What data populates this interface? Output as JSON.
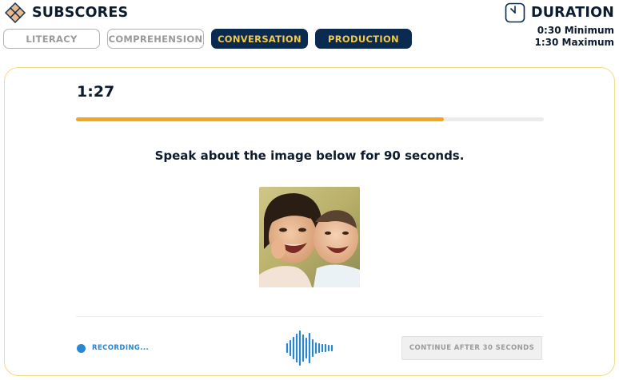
{
  "header": {
    "subscores_title": "SUBSCORES",
    "logo_icon": "diamond-grid-logo-icon",
    "duration_title": "DURATION",
    "duration_icon": "clock-icon",
    "duration_min": "0:30 Minimum",
    "duration_max": "1:30 Maximum"
  },
  "subscores": [
    {
      "label": "LITERACY",
      "active": false
    },
    {
      "label": "COMPREHENSION",
      "active": false
    },
    {
      "label": "CONVERSATION",
      "active": true
    },
    {
      "label": "PRODUCTION",
      "active": true
    }
  ],
  "task": {
    "timer": "1:27",
    "progress_fraction": 0.787,
    "prompt": "Speak about the image below for 90 seconds.",
    "image_subject": "photo of two laughing children"
  },
  "footer": {
    "recording_label": "RECORDING...",
    "waveform_icon": "audio-waveform-icon",
    "continue_label": "CONTINUE AFTER 30 SECONDS"
  },
  "colors": {
    "navy": "#0b2a4f",
    "accent_yellow": "#f5c842",
    "progress": "#f2a81c",
    "recording_blue": "#2a86d1",
    "card_border": "#f2dc86"
  }
}
